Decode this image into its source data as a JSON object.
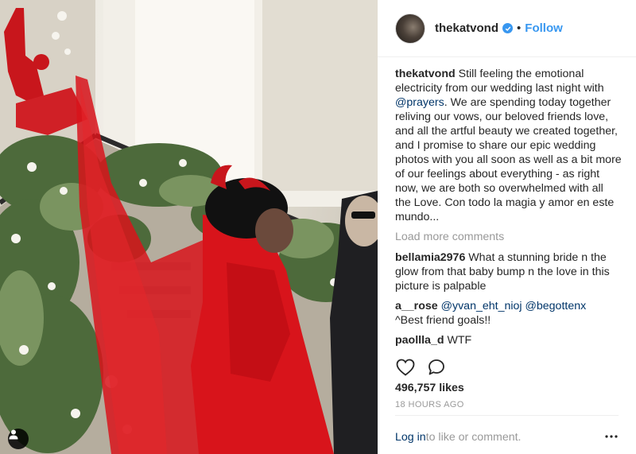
{
  "post": {
    "username": "thekatvond",
    "follow_label": "Follow",
    "separator": "•",
    "caption": {
      "username": "thekatvond",
      "text_before_mention": " Still feeling the emotional electricity from our wedding last night with ",
      "mention": "@prayers",
      "text_after_mention": ". We are spending today together reliving our vows, our beloved friends love, and all the artful beauty we created together, and I promise to share our epic wedding photos with you all soon as well as a bit more of our feelings about everything - as right now, we are both so overwhelmed with all the Love. Con todo la magia y amor en este mundo..."
    },
    "load_more_label": "Load more comments",
    "comments": [
      {
        "username": "bellamia2976",
        "text": " What a stunning bride n the glow from that baby bump n the love in this picture is palpable"
      },
      {
        "username": "a__rose",
        "mention1": " @yvan_eht_nioj",
        "mention2": " @begottenx",
        "text": "^Best friend goals!!"
      },
      {
        "username": "paollla_d",
        "text": " WTF"
      }
    ],
    "likes": "496,757 likes",
    "timestamp": "18 HOURS AGO",
    "footer": {
      "login_label": "Log in",
      "login_suffix": " to like or comment."
    }
  },
  "icons": {
    "verified": "verified-badge-icon",
    "like": "heart-outline-icon",
    "comment": "speech-bubble-icon",
    "more": "more-dots-icon",
    "tag": "user-tag-icon"
  },
  "colors": {
    "accent": "#3897f0",
    "link": "#003569",
    "muted": "#999999",
    "dress": "#d8141b"
  }
}
